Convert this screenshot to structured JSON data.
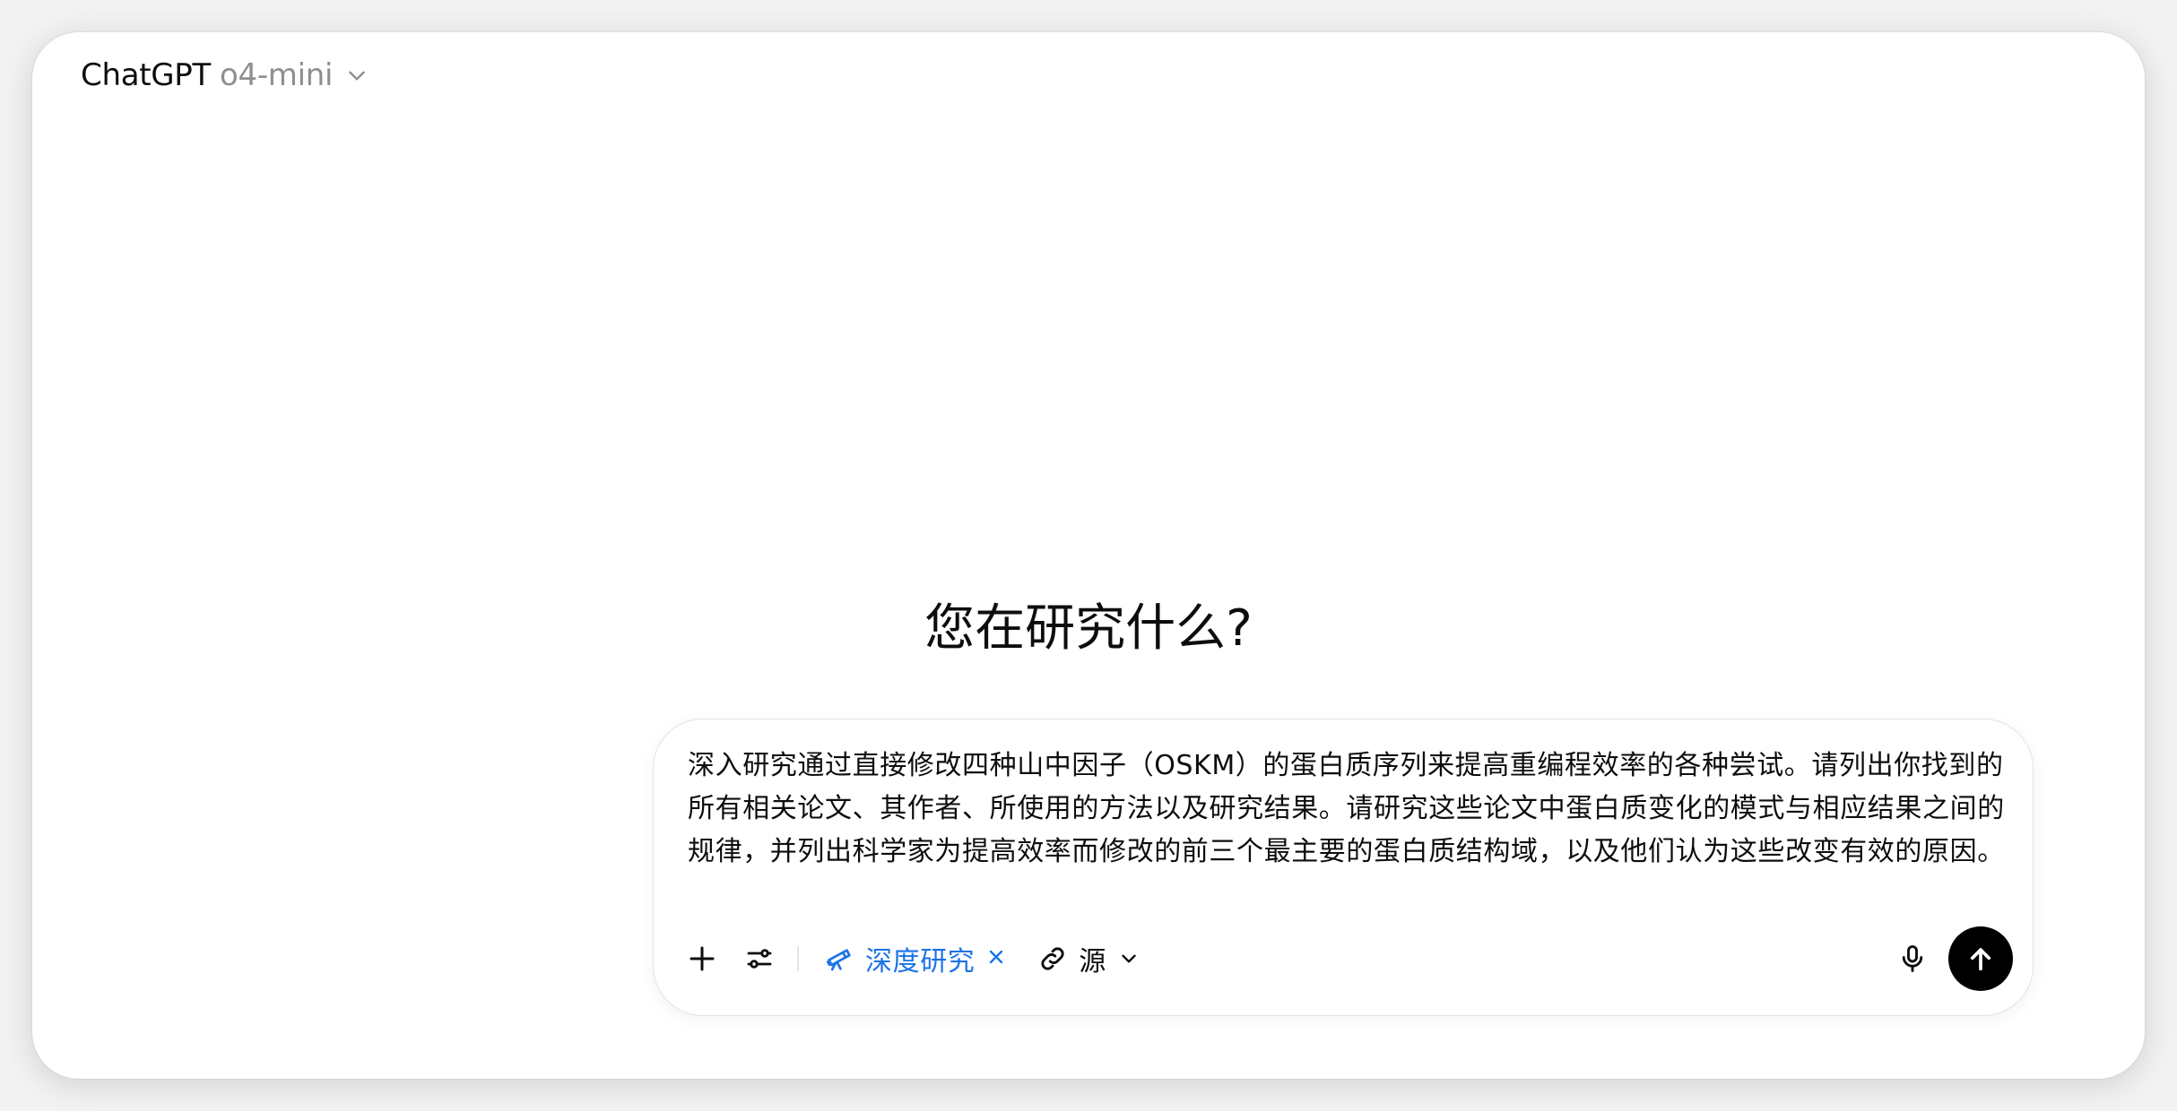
{
  "header": {
    "brand": "ChatGPT",
    "model": "o4-mini",
    "switcher_icon": "chevron-down-icon"
  },
  "main": {
    "headline": "您在研究什么?"
  },
  "composer": {
    "prompt_text": "深入研究通过直接修改四种山中因子（OSKM）的蛋白质序列来提高重编程效率的各种尝试。请列出你找到的所有相关论文、其作者、所使用的方法以及研究结果。请研究这些论文中蛋白质变化的模式与相应结果之间的规律，并列出科学家为提高效率而修改的前三个最主要的蛋白质结构域，以及他们认为这些改变有效的原因。",
    "toolbar": {
      "add_icon": "plus-icon",
      "tools_icon": "sliders-icon",
      "deep_research_label": "深度研究",
      "deep_research_icon": "telescope-icon",
      "remove_icon": "close-icon",
      "sources_label": "源",
      "sources_icon": "link-icon",
      "sources_chevron_icon": "chevron-down-icon",
      "mic_icon": "microphone-icon",
      "send_icon": "arrow-up-icon"
    }
  },
  "colors": {
    "accent_blue": "#1a73e8",
    "text_primary": "#0d0d0d",
    "text_secondary": "#8f8f8f",
    "send_button": "#000000"
  }
}
